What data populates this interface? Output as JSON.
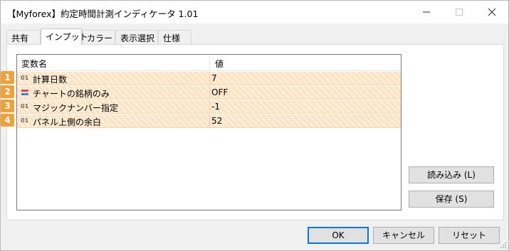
{
  "window": {
    "title": "【Myforex】約定時間計測インディケータ 1.01"
  },
  "titlebar_icons": {
    "minimize": "minimize-icon",
    "maximize": "maximize-icon",
    "close": "close-icon"
  },
  "tabs": [
    {
      "label": "共有"
    },
    {
      "label": "インプット",
      "active": true
    },
    {
      "label": "カラー"
    },
    {
      "label": "表示選択"
    },
    {
      "label": "仕様"
    }
  ],
  "grid": {
    "columns": [
      "変数名",
      "値"
    ],
    "rows": [
      {
        "num": "1",
        "type": "01",
        "name": "計算日数",
        "value": "7"
      },
      {
        "num": "2",
        "type": "bool-icon",
        "name": "チャートの銘柄のみ",
        "value": "OFF"
      },
      {
        "num": "3",
        "type": "01",
        "name": "マジックナンバー指定",
        "value": "-1"
      },
      {
        "num": "4",
        "type": "01",
        "name": "パネル上側の余白",
        "value": "52"
      }
    ]
  },
  "side_buttons": {
    "load": "読み込み (L)",
    "save": "保存 (S)"
  },
  "footer": {
    "ok": "OK",
    "cancel": "キャンセル",
    "reset": "リセット"
  },
  "colors": {
    "row_highlight": "#fbe3c5",
    "row_number_badge": "#f0a23a",
    "default_button_border": "#0078d7"
  }
}
